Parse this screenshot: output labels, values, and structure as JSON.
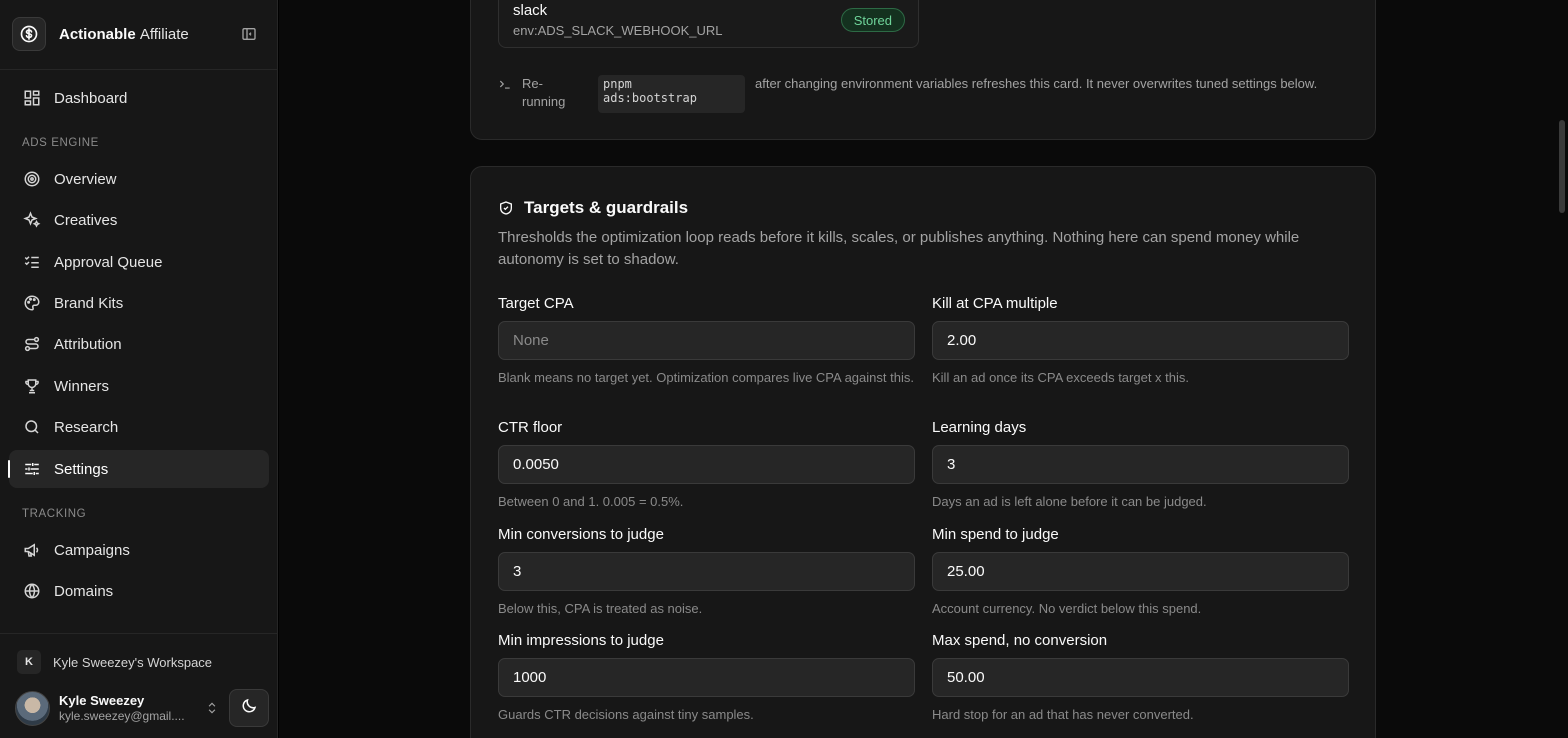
{
  "app": {
    "brand_main": "Actionable",
    "brand_accent": "Affiliate"
  },
  "sidebar": {
    "dashboard": "Dashboard",
    "sections": {
      "ads_engine": "ADS ENGINE",
      "tracking": "TRACKING"
    },
    "ads_engine_items": [
      {
        "label": "Overview",
        "icon": "target-icon"
      },
      {
        "label": "Creatives",
        "icon": "sparkles-icon"
      },
      {
        "label": "Approval Queue",
        "icon": "list-check-icon"
      },
      {
        "label": "Brand Kits",
        "icon": "palette-icon"
      },
      {
        "label": "Attribution",
        "icon": "route-icon"
      },
      {
        "label": "Winners",
        "icon": "trophy-icon"
      },
      {
        "label": "Research",
        "icon": "search-icon"
      },
      {
        "label": "Settings",
        "icon": "sliders-icon",
        "active": true
      }
    ],
    "tracking_items": [
      {
        "label": "Campaigns",
        "icon": "megaphone-icon"
      },
      {
        "label": "Domains",
        "icon": "globe-icon"
      }
    ],
    "workspace": {
      "badge": "K",
      "name": "Kyle Sweezey's Workspace"
    },
    "user": {
      "name": "Kyle Sweezey",
      "email": "kyle.sweezey@gmail...."
    }
  },
  "env_card": {
    "secret_name": "slack",
    "secret_env": "env:ADS_SLACK_WEBHOOK_URL",
    "status": "Stored",
    "rerun_prefix": "Re-running",
    "rerun_command": "pnpm\nads:bootstrap",
    "rerun_suffix": "after changing environment variables refreshes this card. It never overwrites tuned settings below."
  },
  "guardrails": {
    "title": "Targets & guardrails",
    "description": "Thresholds the optimization loop reads before it kills, scales, or publishes anything. Nothing here can spend money while autonomy is set to shadow.",
    "fields": {
      "target_cpa": {
        "label": "Target CPA",
        "value": "",
        "placeholder": "None",
        "help": "Blank means no target yet. Optimization compares live CPA against this."
      },
      "kill_cpa_multiple": {
        "label": "Kill at CPA multiple",
        "value": "2.00",
        "help": "Kill an ad once its CPA exceeds target x this."
      },
      "ctr_floor": {
        "label": "CTR floor",
        "value": "0.0050",
        "help": "Between 0 and 1. 0.005 = 0.5%."
      },
      "learning_days": {
        "label": "Learning days",
        "value": "3",
        "help": "Days an ad is left alone before it can be judged."
      },
      "min_conversions": {
        "label": "Min conversions to judge",
        "value": "3",
        "help": "Below this, CPA is treated as noise."
      },
      "min_spend": {
        "label": "Min spend to judge",
        "value": "25.00",
        "help": "Account currency. No verdict below this spend."
      },
      "min_impressions": {
        "label": "Min impressions to judge",
        "value": "1000",
        "help": "Guards CTR decisions against tiny samples."
      },
      "max_spend_no_conv": {
        "label": "Max spend, no conversion",
        "value": "50.00",
        "help": "Hard stop for an ad that has never converted."
      }
    }
  },
  "colors": {
    "background": "#0a0a0a",
    "sidebar": "#171717",
    "card": "#171717",
    "stored_badge": "#6fd49a"
  }
}
